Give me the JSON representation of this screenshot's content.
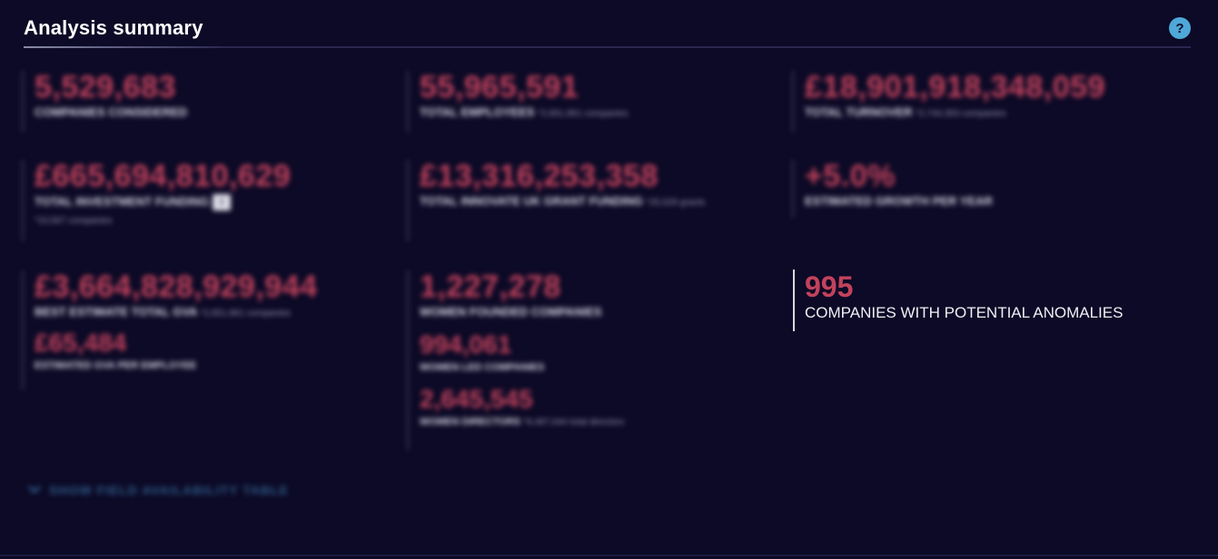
{
  "header": {
    "title": "Analysis summary",
    "help_icon": "?"
  },
  "stats": [
    {
      "value": "5,529,683",
      "label": "COMPANIES CONSIDERED",
      "note": ""
    },
    {
      "value": "55,965,591",
      "label": "TOTAL EMPLOYEES",
      "note": "*2,651,961 companies"
    },
    {
      "value": "£18,901,918,348,059",
      "label": "TOTAL TURNOVER",
      "note": "*2,744,353 companies"
    },
    {
      "value": "£665,694,810,629",
      "label": "TOTAL INVESTMENT FUNDING",
      "badge": "i",
      "note": "*10,567 companies"
    },
    {
      "value": "£13,316,253,358",
      "label": "TOTAL INNOVATE UK GRANT FUNDING",
      "note": "*25,529 grants"
    },
    {
      "value": "+5.0%",
      "label": "ESTIMATED GROWTH PER YEAR",
      "note": ""
    },
    {
      "value": "£3,664,828,929,944",
      "label": "BEST ESTIMATE TOTAL GVA",
      "note": "*2,651,961 companies",
      "sub_value": "£65,484",
      "sub_label": "ESTIMATED GVA PER EMPLOYEE"
    },
    {
      "value": "1,227,278",
      "label": "WOMEN FOUNDED COMPANIES",
      "note": "",
      "sub_value": "994,061",
      "sub_label": "WOMEN LED COMPANIES",
      "sub_value_2": "2,645,545",
      "sub_label_2": "WOMEN DIRECTORS",
      "sub_note_2": "*9,497,044 total directors"
    }
  ],
  "anomalies": {
    "value": "995",
    "label": "COMPANIES WITH POTENTIAL ANOMALIES"
  },
  "toggle": {
    "icon": "chevron-down",
    "label": "SHOW FIELD AVAILABILITY TABLE"
  },
  "colors": {
    "background": "#0c0a26",
    "accent": "#c3425c",
    "link": "#2f5a86",
    "help": "#4ea8d8"
  }
}
